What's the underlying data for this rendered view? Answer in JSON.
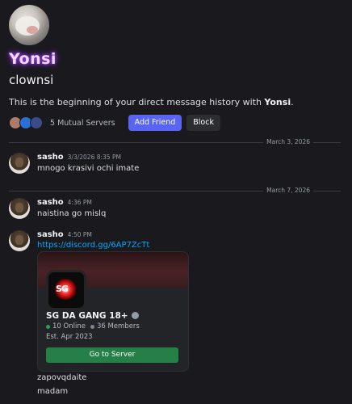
{
  "profile": {
    "display_name": "Yonsi",
    "username": "clownsi",
    "intro_prefix": "This is the beginning of your direct message history with ",
    "intro_name": "Yonsi",
    "intro_suffix": ".",
    "mutual_servers": "5 Mutual Servers",
    "add_friend": "Add Friend",
    "block": "Block"
  },
  "dividers": [
    {
      "label": "March 3, 2026"
    },
    {
      "label": "March 7, 2026"
    }
  ],
  "messages": [
    {
      "author": "sasho",
      "timestamp": "3/3/2026 8:35 PM",
      "text": "mnogo krasivi ochi imate"
    },
    {
      "author": "sasho",
      "timestamp": "4:36 PM",
      "text": "naistina go mislq"
    },
    {
      "author": "sasho",
      "timestamp": "4:50 PM",
      "link": "https://discord.gg/6AP7ZcTt"
    }
  ],
  "invite": {
    "icon_text": "SG",
    "server_name": "SG DA GANG 18+",
    "online": "10 Online",
    "members": "36 Members",
    "established": "Est. Apr 2023",
    "button": "Go to Server"
  },
  "followups": [
    "zapovqdaite",
    "madam"
  ]
}
